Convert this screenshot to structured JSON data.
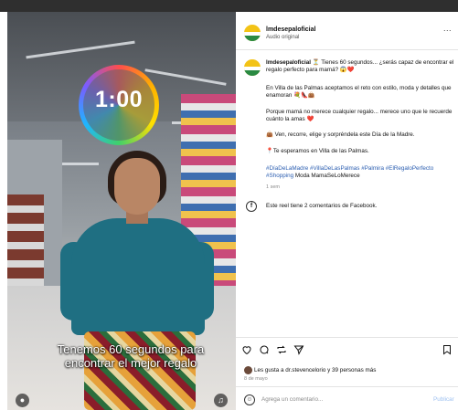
{
  "post": {
    "username": "lmdesepaloficial",
    "audio_label": "Audio original",
    "more_label": "...",
    "caption": {
      "username": "lmdesepaloficial",
      "line1": "⏳ Tienes 60 segundos... ¿serás capaz de encontrar el regalo perfecto para mamá? 😱❤️",
      "para2": "En Villa de las Palmas aceptamos el reto con estilo, moda y detalles que enamoran 💐👠👜",
      "para3_text": "Porque mamá no merece cualquier regalo... merece uno que le recuerde cuánto la amas",
      "para3_emoji": "❤️",
      "para4": "👜 Ven, recorre, elige y sorpréndela este Día de la Madre.",
      "para5": "📍Te esperamos en Villa de las Palmas.",
      "hashtags": "#DíaDeLaMadre #VillaDeLasPalmas #Palmira #ElRegaloPerfecto #Shopping",
      "hashtags_tail": "Moda MamaSeLoMerece",
      "time_ago": "1 sem"
    },
    "facebook_note": "Este reel tiene 2 comentarios de Facebook.",
    "likes_text_bold": "Les gusta a dr.stevencelorio y 39 personas más",
    "date": "8 de mayo",
    "comment_placeholder": "Agrega un comentario...",
    "publish_label": "Publicar"
  },
  "video": {
    "timer": "1:00",
    "subtitle_line1": "Tenemos 60 segundos para",
    "subtitle_line2": "encontrar el mejor regalo",
    "profile_button_icon": "person-icon",
    "mute_button_icon": "speaker-icon"
  },
  "icons": {
    "like": "heart-icon",
    "comment": "comment-icon",
    "share": "repost-icon",
    "send": "send-icon",
    "save": "bookmark-icon",
    "facebook": "facebook-icon",
    "emoji": "emoji-icon"
  },
  "colors": {
    "link": "#2a5db0",
    "publish_disabled": "#9ec1f0",
    "teal_top": "#1f6f82"
  }
}
